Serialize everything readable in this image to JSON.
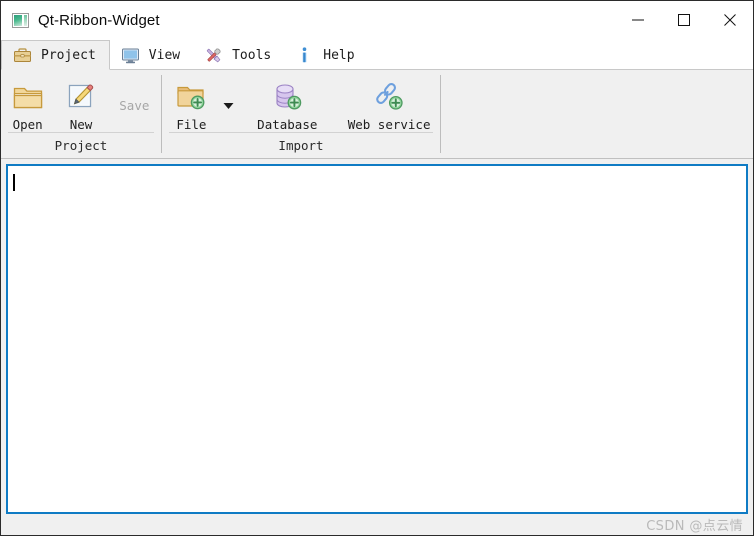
{
  "window": {
    "title": "Qt-Ribbon-Widget",
    "app_icon": "image-app-icon",
    "controls": {
      "minimize": "minimize-icon",
      "maximize": "maximize-icon",
      "close": "close-icon"
    }
  },
  "tabs": [
    {
      "label": "Project",
      "icon": "briefcase-icon",
      "selected": true
    },
    {
      "label": "View",
      "icon": "monitor-icon",
      "selected": false
    },
    {
      "label": "Tools",
      "icon": "wrench-screwdriver-icon",
      "selected": false
    },
    {
      "label": "Help",
      "icon": "info-icon",
      "selected": false
    }
  ],
  "ribbon": {
    "groups": [
      {
        "label": "Project",
        "buttons": [
          {
            "label": "Open",
            "icon": "open-folder-icon",
            "enabled": true,
            "has_dropdown": false
          },
          {
            "label": "New",
            "icon": "pencil-page-icon",
            "enabled": true,
            "has_dropdown": false
          },
          {
            "label": "Save",
            "icon": "none",
            "enabled": false,
            "has_dropdown": false
          }
        ]
      },
      {
        "label": "Import",
        "buttons": [
          {
            "label": "File",
            "icon": "folder-add-icon",
            "enabled": true,
            "has_dropdown": true
          },
          {
            "label": "Database",
            "icon": "database-add-icon",
            "enabled": true,
            "has_dropdown": false
          },
          {
            "label": "Web service",
            "icon": "chain-link-add-icon",
            "enabled": true,
            "has_dropdown": false
          }
        ]
      }
    ]
  },
  "editor": {
    "value": "",
    "placeholder": "",
    "caret_visible": true
  },
  "footer": {
    "watermark": "CSDN @点云情"
  },
  "colors": {
    "accent_border": "#0f7bc4",
    "chrome": "#f0f0f0",
    "titlebar": "#ffffff",
    "separator": "#c8c8c8",
    "disabled_text": "#a6a6a6",
    "watermark_text": "#b9b9b9"
  }
}
